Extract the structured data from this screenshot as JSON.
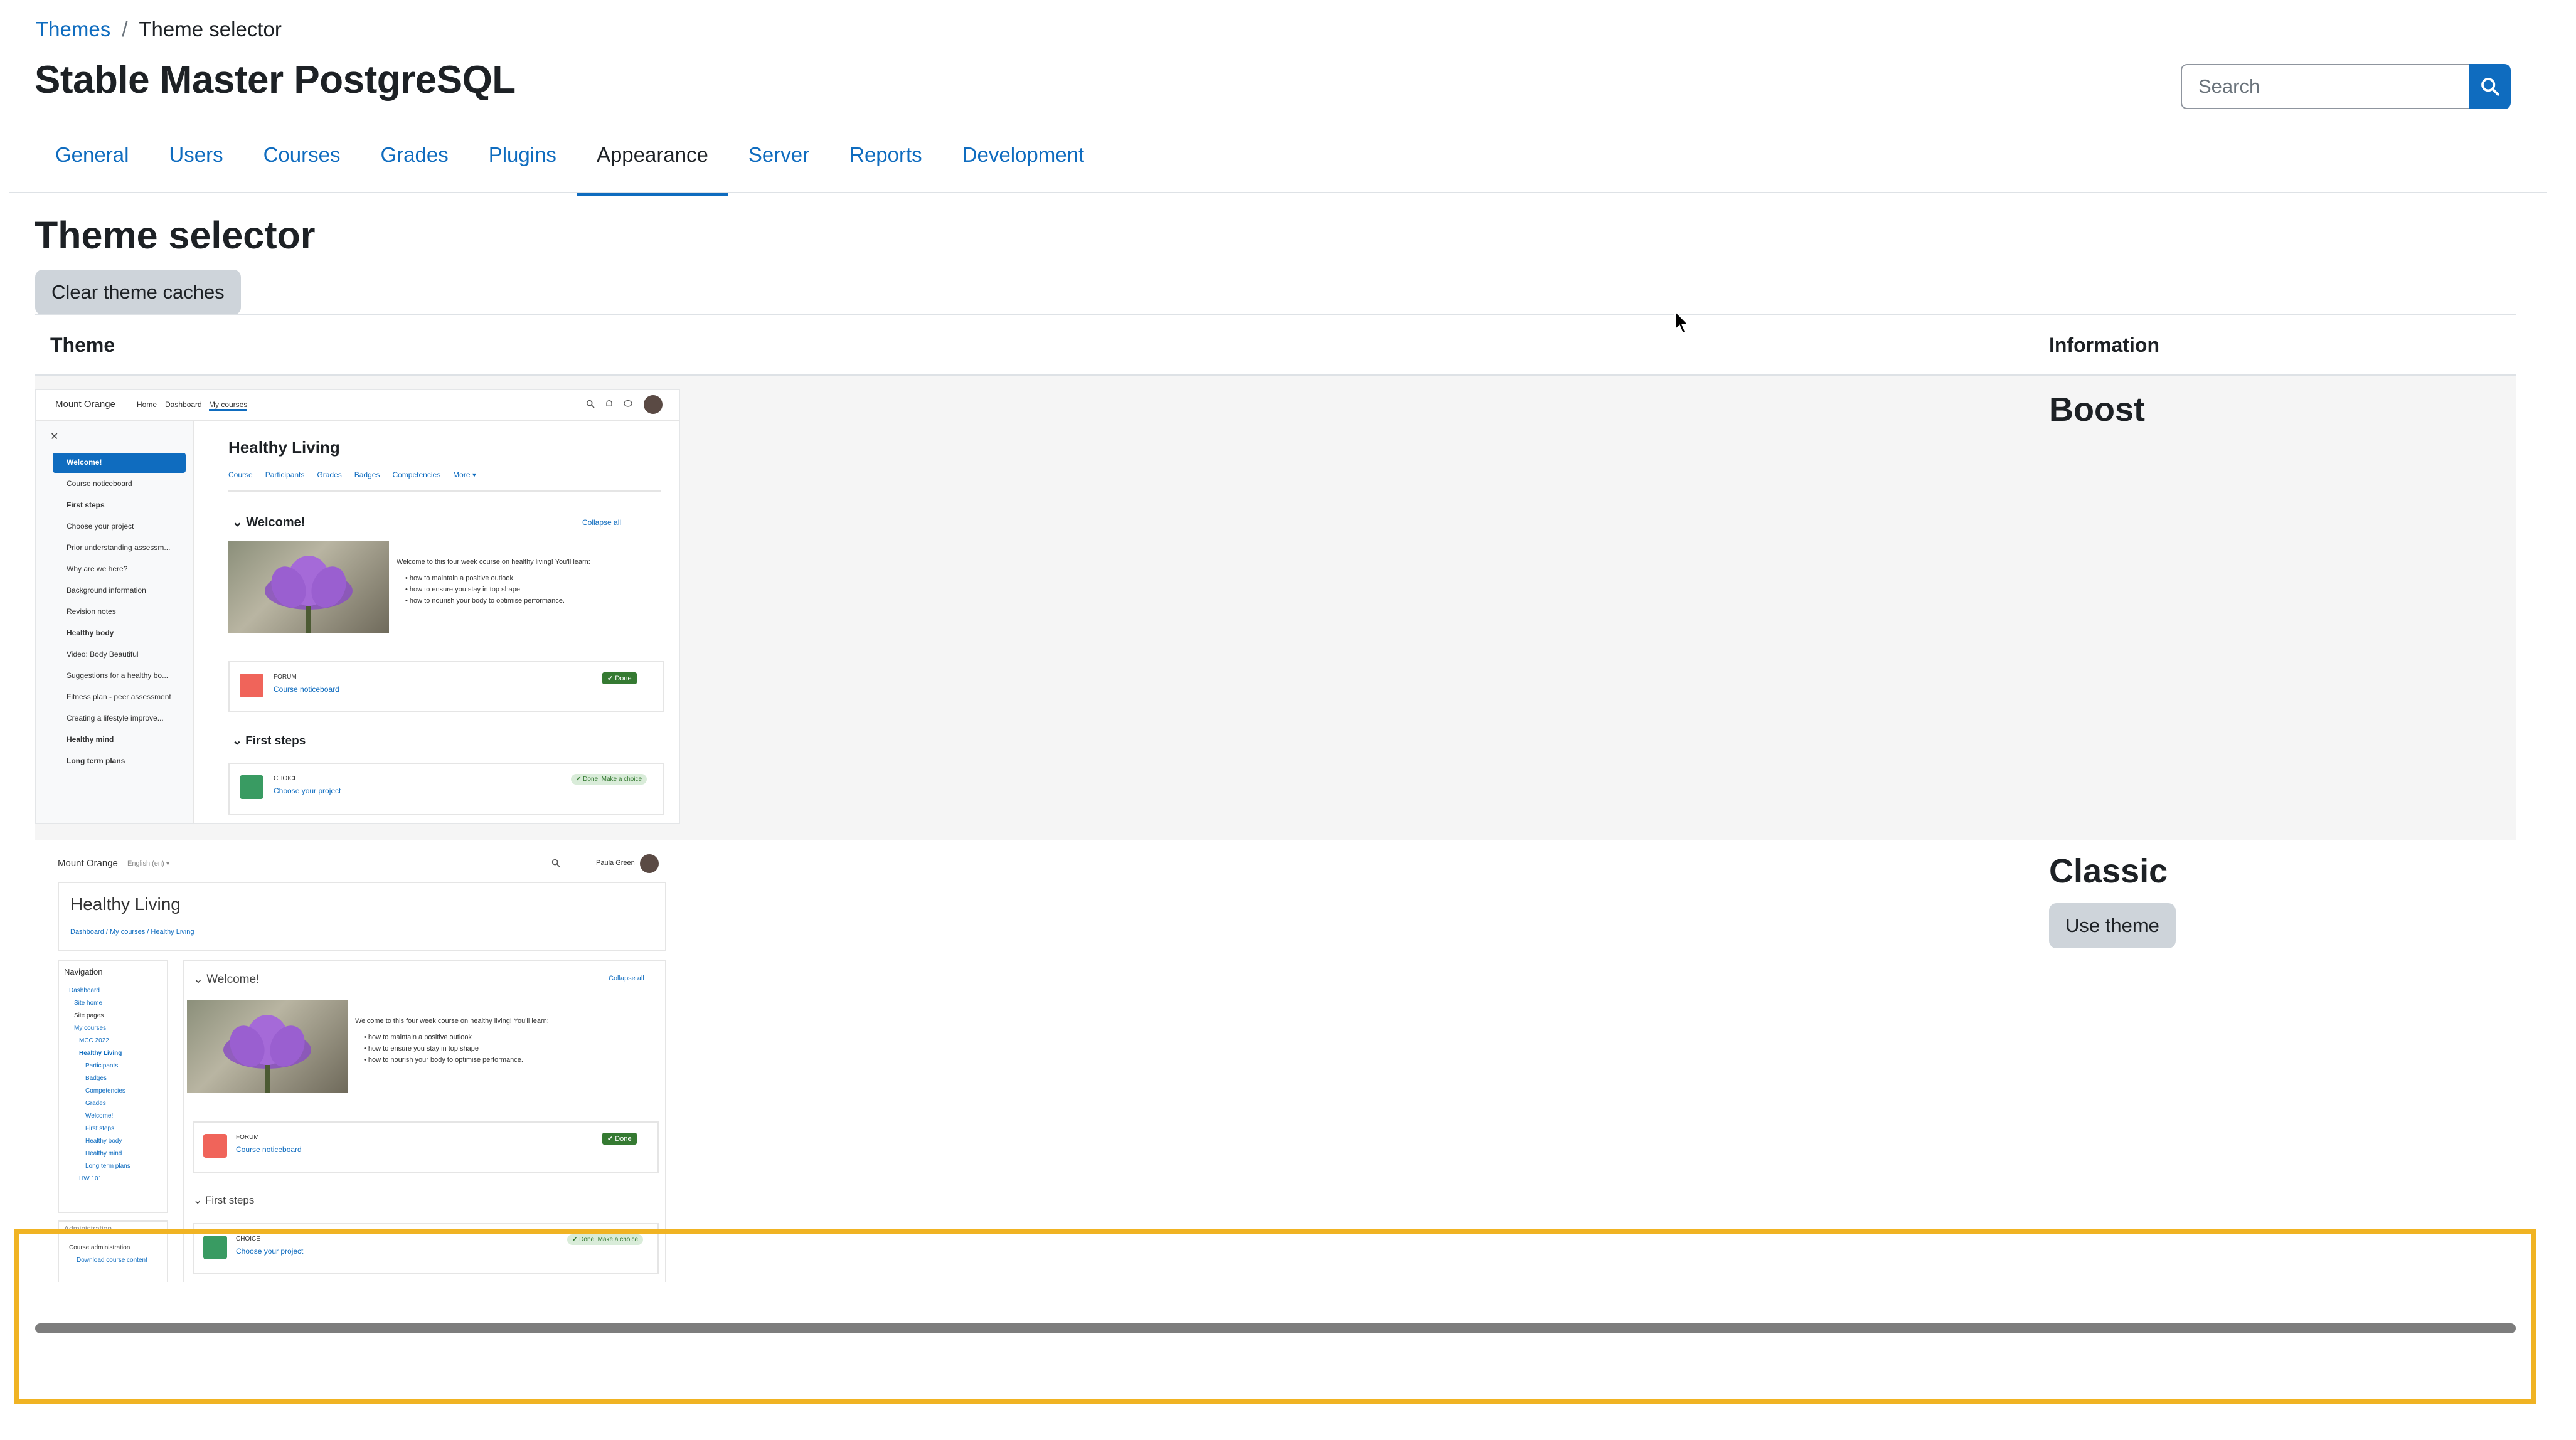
{
  "breadcrumb": {
    "parent": "Themes",
    "separator": "/",
    "current": "Theme selector"
  },
  "site_title": "Stable Master PostgreSQL",
  "search": {
    "placeholder": "Search",
    "icon": "search-icon"
  },
  "tabs": [
    {
      "label": "General",
      "active": false
    },
    {
      "label": "Users",
      "active": false
    },
    {
      "label": "Courses",
      "active": false
    },
    {
      "label": "Grades",
      "active": false
    },
    {
      "label": "Plugins",
      "active": false
    },
    {
      "label": "Appearance",
      "active": true
    },
    {
      "label": "Server",
      "active": false
    },
    {
      "label": "Reports",
      "active": false
    },
    {
      "label": "Development",
      "active": false
    }
  ],
  "page_heading": "Theme selector",
  "clear_caches_label": "Clear theme caches",
  "table": {
    "col_theme": "Theme",
    "col_information": "Information",
    "rows": [
      {
        "name": "Boost",
        "current": true
      },
      {
        "name": "Classic",
        "action_label": "Use theme"
      }
    ]
  },
  "preview_boost": {
    "site": "Mount Orange",
    "nav": [
      "Home",
      "Dashboard",
      "My courses"
    ],
    "course_title": "Healthy Living",
    "course_tabs": [
      "Course",
      "Participants",
      "Grades",
      "Badges",
      "Competencies",
      "More ▾"
    ],
    "section_welcome": "Welcome!",
    "collapse_all": "Collapse all",
    "intro": "Welcome to this four week course on healthy living! You'll learn:",
    "bullets": [
      "how to maintain a positive outlook",
      "how to ensure you stay in top shape",
      "how to nourish your body to optimise performance."
    ],
    "forum_type": "FORUM",
    "forum_name": "Course noticeboard",
    "done": "✔ Done",
    "section_first_steps": "First steps",
    "choice_type": "CHOICE",
    "choice_name": "Choose your project",
    "choice_status": "✔ Done: Make a choice",
    "sidebar": [
      "Welcome!",
      "Course noticeboard",
      "First steps",
      "Choose your project",
      "Prior understanding assessm...",
      "Why are we here?",
      "Background information",
      "Revision notes",
      "Healthy body",
      "Video: Body Beautiful",
      "Suggestions for a healthy bo...",
      "Fitness plan - peer assessment",
      "Creating a lifestyle improve...",
      "Healthy mind",
      "Long term plans"
    ]
  },
  "preview_classic": {
    "site": "Mount Orange",
    "lang": "English (en) ▾",
    "user": "Paula Green",
    "course_title": "Healthy Living",
    "crumbs": "Dashboard / My courses / Healthy Living",
    "nav_title": "Navigation",
    "nav_items": [
      "Dashboard",
      "Site home",
      "Site pages",
      "My courses",
      "MCC 2022",
      "Healthy Living",
      "Participants",
      "Badges",
      "Competencies",
      "Grades",
      "Welcome!",
      "First steps",
      "Healthy body",
      "Healthy mind",
      "Long term plans",
      "HW 101"
    ],
    "admin_title": "Administration",
    "admin_items": [
      "Course administration",
      "Download course content"
    ],
    "section_welcome": "Welcome!",
    "collapse_all": "Collapse all",
    "intro": "Welcome to this four week course on healthy living! You'll learn:",
    "bullets": [
      "how to maintain a positive outlook",
      "how to ensure you stay in top shape",
      "how to nourish your body to optimise performance."
    ],
    "forum_type": "FORUM",
    "forum_name": "Course noticeboard",
    "done": "✔ Done",
    "section_first_steps": "First steps",
    "choice_type": "CHOICE",
    "choice_name": "Choose your project",
    "choice_status": "✔ Done: Make a choice"
  },
  "colors": {
    "link": "#0f6cbf",
    "highlight": "#f0b323",
    "row_bg": "#f5f5f5"
  }
}
